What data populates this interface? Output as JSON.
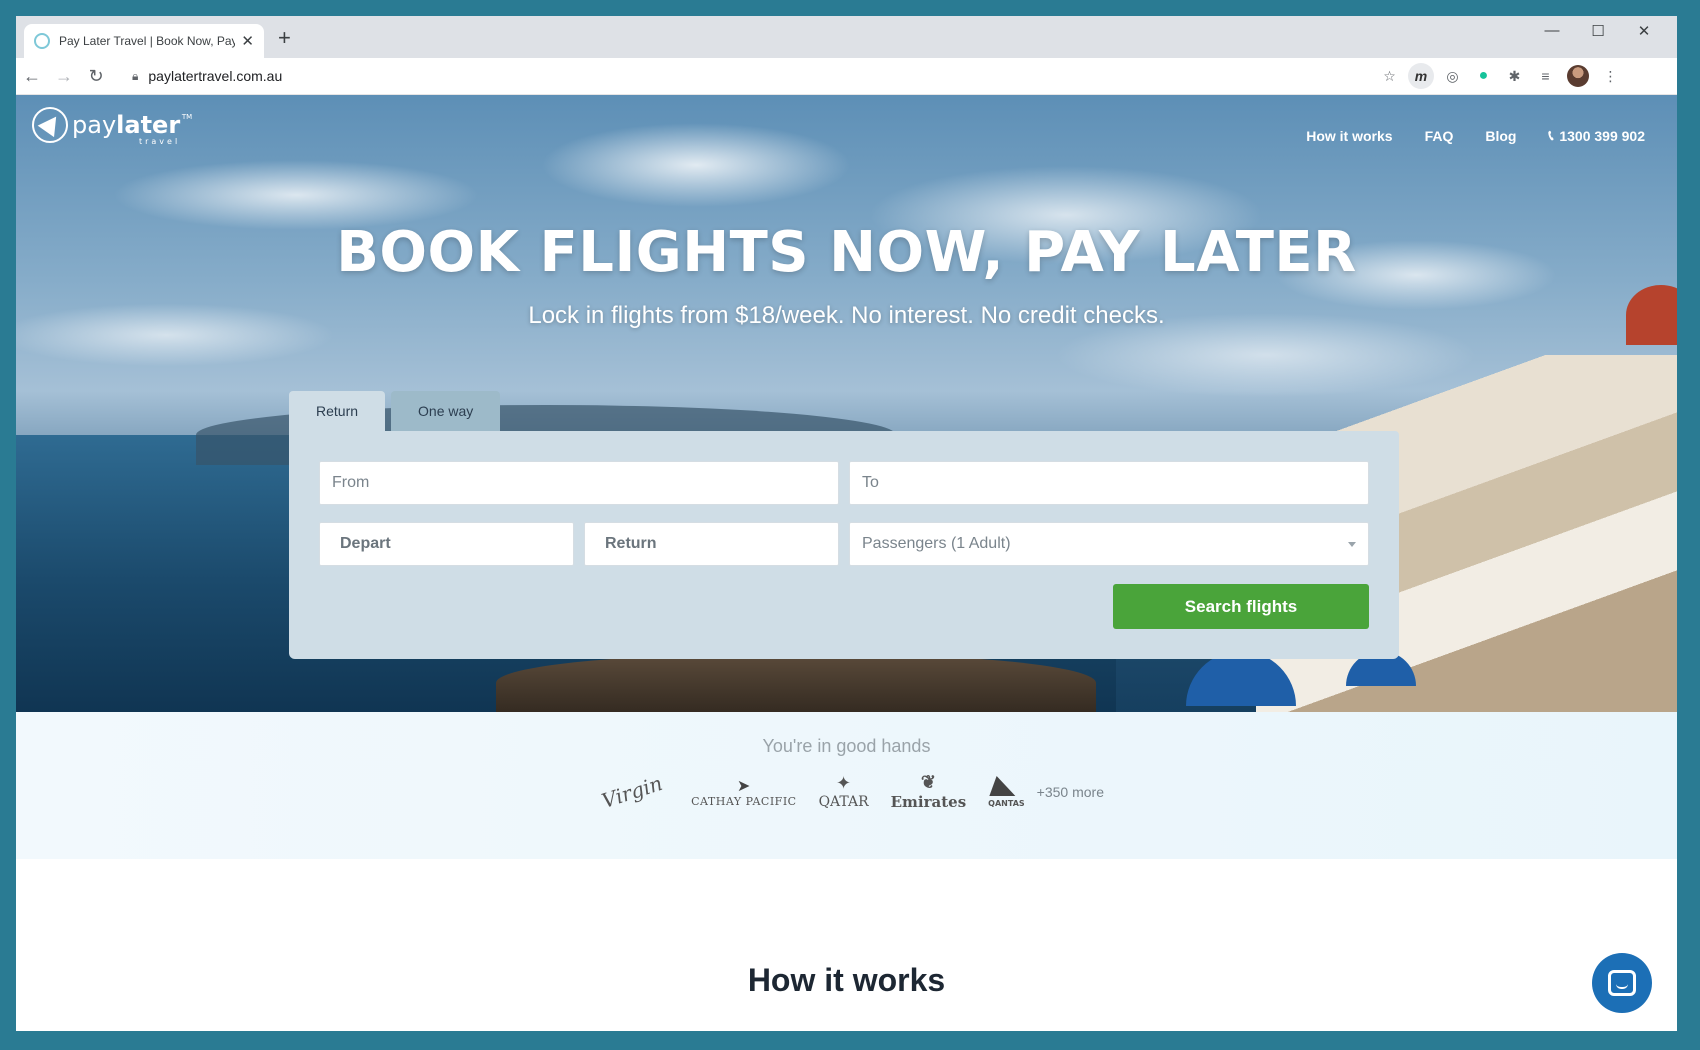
{
  "browser": {
    "tab_title": "Pay Later Travel | Book Now, Pay",
    "tab_close": "✕",
    "new_tab": "+",
    "url": "paylatertravel.com.au",
    "controls": {
      "minimize": "—",
      "maximize": "☐",
      "close": "✕"
    },
    "nav": {
      "back": "←",
      "forward": "→",
      "reload": "↻"
    },
    "ext_m": "m"
  },
  "site": {
    "brand": {
      "pay": "pay",
      "later": "later",
      "tm": "TM",
      "sub": "travel"
    },
    "nav": [
      {
        "label": "How it works"
      },
      {
        "label": "FAQ"
      },
      {
        "label": "Blog"
      }
    ],
    "phone": "1300 399 902",
    "headline": "BOOK FLIGHTS NOW, PAY LATER",
    "subheadline": "Lock in flights from $18/week. No interest. No credit checks."
  },
  "search": {
    "tabs": [
      {
        "label": "Return",
        "active": true
      },
      {
        "label": "One way",
        "active": false
      }
    ],
    "from_placeholder": "From",
    "to_placeholder": "To",
    "depart_placeholder": "Depart",
    "return_placeholder": "Return",
    "passengers_value": "Passengers (1 Adult)",
    "submit_label": "Search flights"
  },
  "trust": {
    "title": "You're in good hands",
    "airlines": [
      {
        "name": "Virgin"
      },
      {
        "name": "CATHAY PACIFIC"
      },
      {
        "name": "QATAR"
      },
      {
        "name": "Emirates"
      },
      {
        "name": "QANTAS"
      }
    ],
    "more": "+350 more"
  },
  "how_it_works_title": "How it works",
  "colors": {
    "accent_green": "#4aa43a",
    "chat_blue": "#1c6fb6",
    "card_bg": "#cfdde6"
  }
}
